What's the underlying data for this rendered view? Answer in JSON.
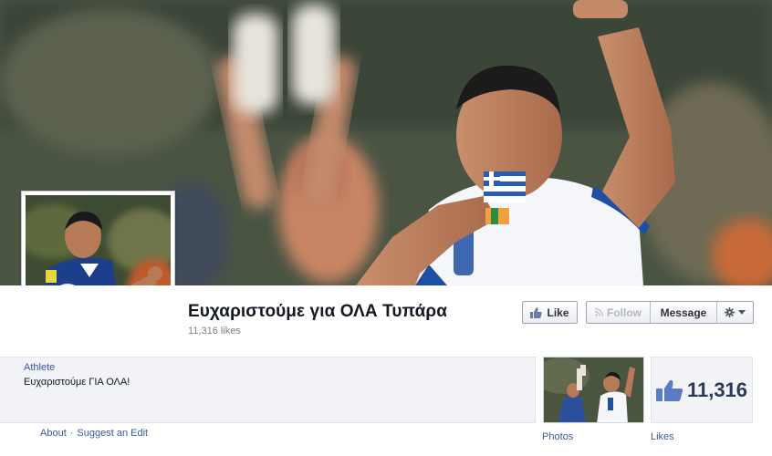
{
  "page": {
    "title": "Ευχαριστούμε για ΟΛΑ Τυπάρα",
    "likes_text": "11,316 likes",
    "category": "Athlete",
    "about": "Ευχαριστούμε ΓΙΑ ΟΛΑ!"
  },
  "actions": {
    "like_label": "Like",
    "follow_label": "Follow",
    "message_label": "Message"
  },
  "links": {
    "about": "About",
    "separator": "·",
    "suggest_edit": "Suggest an Edit"
  },
  "tiles": {
    "photos_label": "Photos",
    "likes_count": "11,316",
    "likes_label": "Likes"
  },
  "colors": {
    "link_blue": "#3b5998",
    "panel_bg": "#f2f3f7",
    "jersey_white": "#f4f6fa",
    "jersey_blue": "#1f4fa3"
  },
  "icons": {
    "like": "thumbs-up-icon",
    "follow": "rss-icon",
    "settings": "gear-icon",
    "dropdown": "caret-down-icon",
    "likes_tile": "thumbs-up-icon"
  }
}
